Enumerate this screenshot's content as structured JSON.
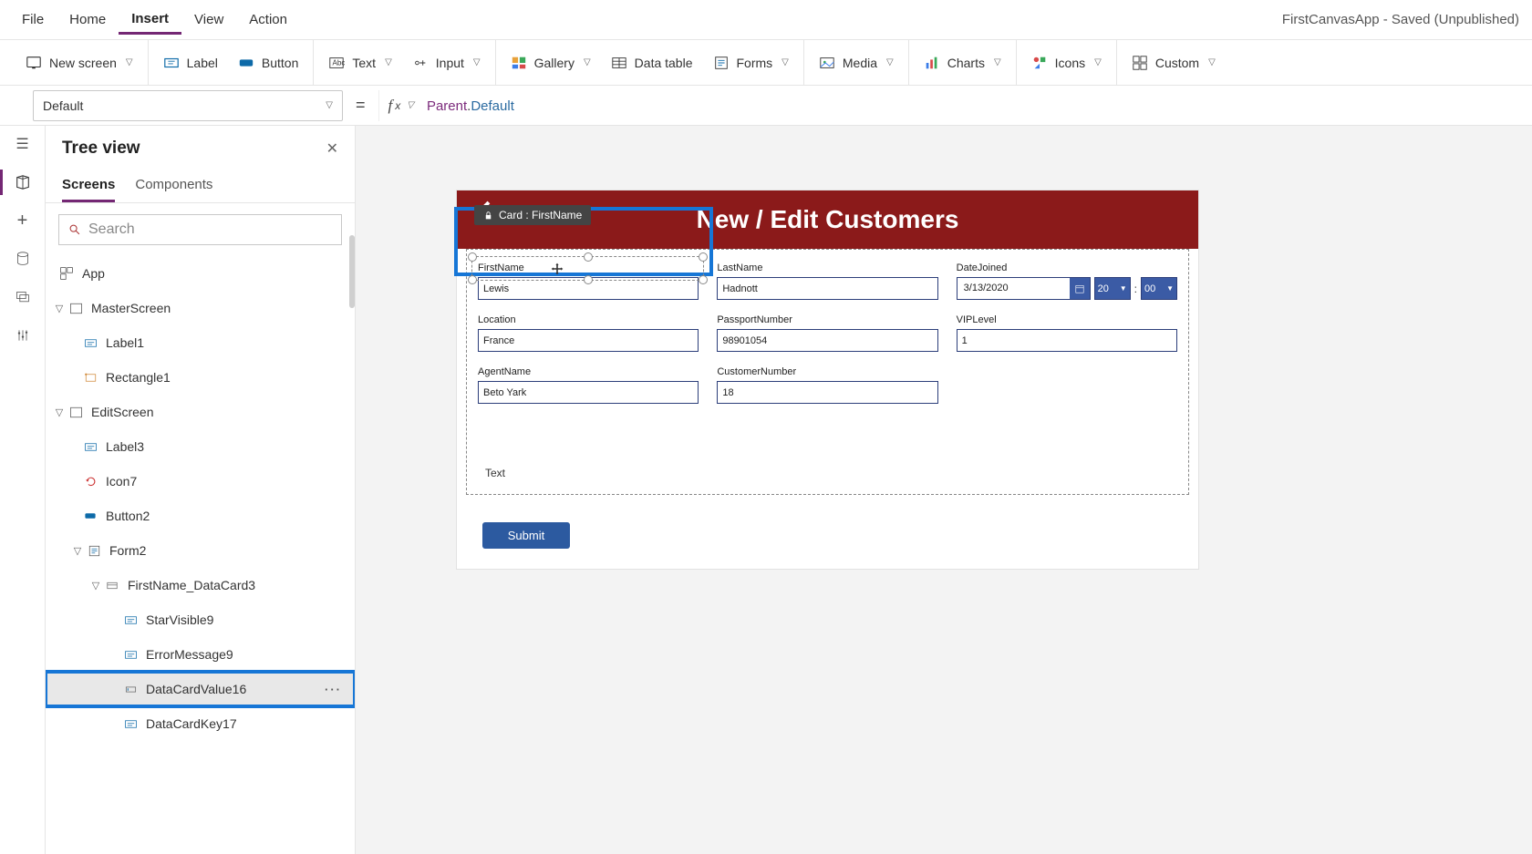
{
  "appTitle": "FirstCanvasApp - Saved (Unpublished)",
  "menu": {
    "items": [
      "File",
      "Home",
      "Insert",
      "View",
      "Action"
    ],
    "active": "Insert"
  },
  "ribbon": {
    "newScreen": "New screen",
    "label": "Label",
    "button": "Button",
    "text": "Text",
    "input": "Input",
    "gallery": "Gallery",
    "dataTable": "Data table",
    "forms": "Forms",
    "media": "Media",
    "charts": "Charts",
    "icons": "Icons",
    "custom": "Custom"
  },
  "property": {
    "name": "Default"
  },
  "formula": {
    "parent": "Parent",
    "member": "Default"
  },
  "tree": {
    "title": "Tree view",
    "tabs": {
      "screens": "Screens",
      "components": "Components"
    },
    "searchPlaceholder": "Search",
    "app": "App",
    "masterScreen": "MasterScreen",
    "label1": "Label1",
    "rectangle1": "Rectangle1",
    "editScreen": "EditScreen",
    "label3": "Label3",
    "icon7": "Icon7",
    "button2": "Button2",
    "form2": "Form2",
    "dc3": "FirstName_DataCard3",
    "star9": "StarVisible9",
    "err9": "ErrorMessage9",
    "dcv16": "DataCardValue16",
    "dck17": "DataCardKey17"
  },
  "cardTip": "Card : FirstName",
  "screenTitle": "New / Edit Customers",
  "fields": {
    "firstName": {
      "label": "FirstName",
      "value": "Lewis"
    },
    "lastName": {
      "label": "LastName",
      "value": "Hadnott"
    },
    "dateJoined": {
      "label": "DateJoined",
      "date": "3/13/2020",
      "hour": "20",
      "minute": "00"
    },
    "location": {
      "label": "Location",
      "value": "France"
    },
    "passport": {
      "label": "PassportNumber",
      "value": "98901054"
    },
    "vip": {
      "label": "VIPLevel",
      "value": "1"
    },
    "agent": {
      "label": "AgentName",
      "value": "Beto Yark"
    },
    "custNo": {
      "label": "CustomerNumber",
      "value": "18"
    }
  },
  "textLabel": "Text",
  "submit": "Submit"
}
